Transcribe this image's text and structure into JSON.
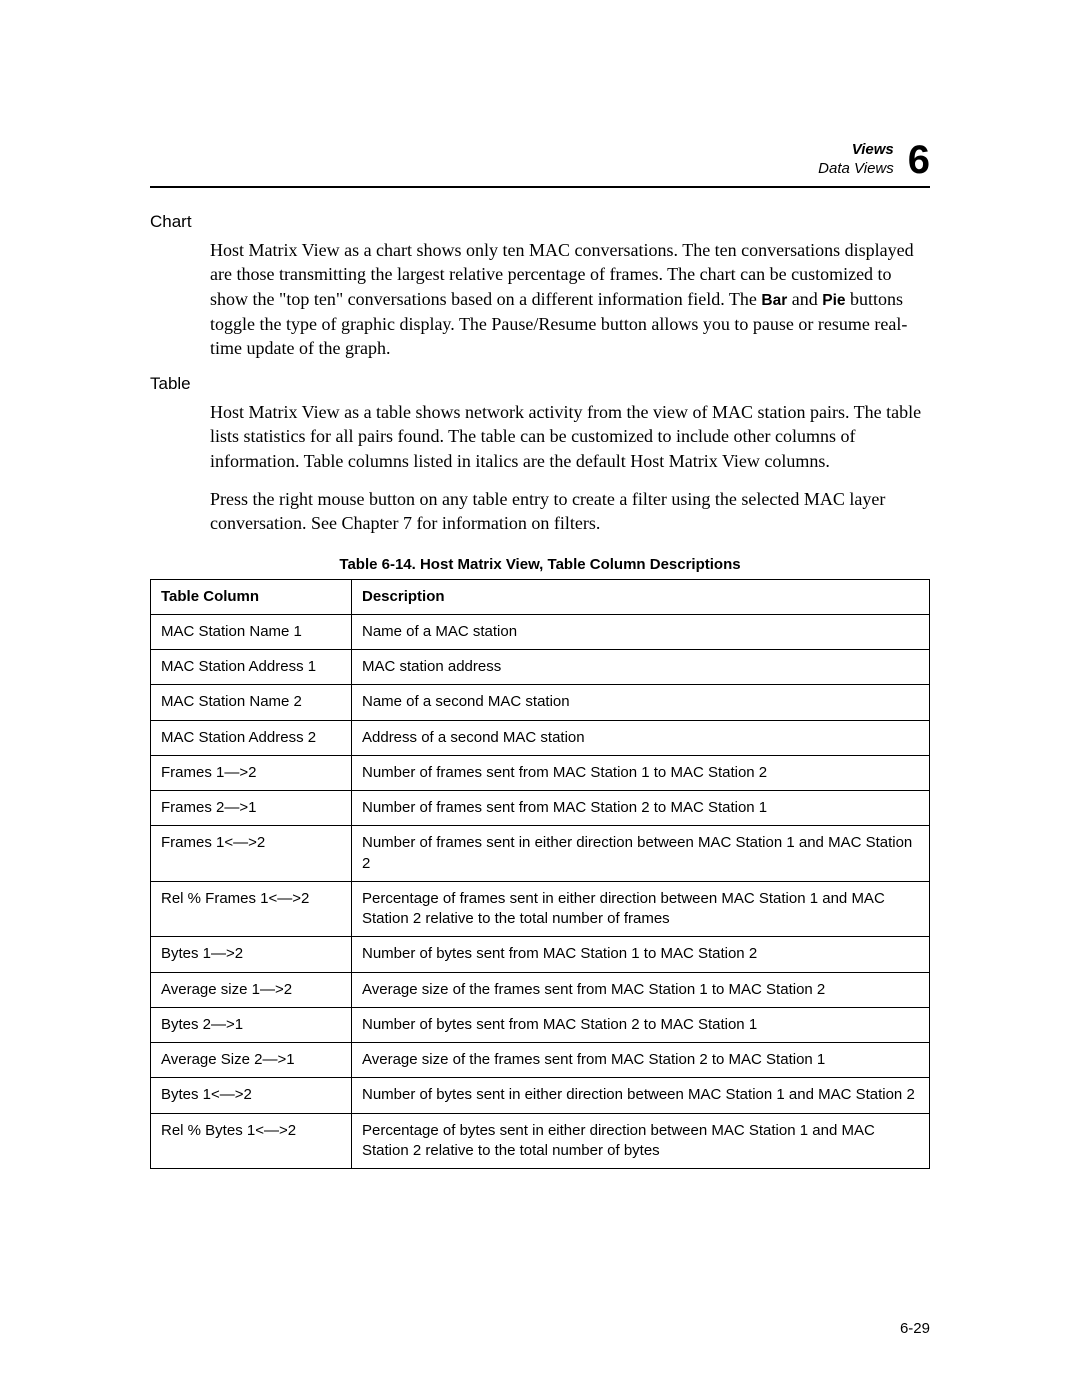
{
  "header": {
    "line1": "Views",
    "line2": "Data Views",
    "chapter_number": "6"
  },
  "sections": {
    "chart": {
      "heading": "Chart",
      "para_pre": "Host Matrix View as a chart shows only ten MAC conversations. The ten conversations displayed are those transmitting the largest relative percentage of frames. The chart can be customized to show the \"top ten\" conversations based on a different information field. The ",
      "bar_label": "Bar",
      "mid1": " and ",
      "pie_label": "Pie",
      "para_post": " buttons toggle the type of graphic display. The Pause/Resume button allows you to pause or resume real-time update of the graph."
    },
    "table": {
      "heading": "Table",
      "para1": "Host Matrix View as a table shows network activity from the view of MAC station pairs. The table lists statistics for all pairs found. The table can be customized to include other columns of information. Table columns listed in italics are the default Host Matrix View columns.",
      "para2": "Press the right mouse button on any table entry to create a filter using the selected MAC layer conversation. See Chapter 7 for information on filters."
    }
  },
  "table_caption": "Table 6-14. Host Matrix View, Table Column Descriptions",
  "table_headers": {
    "col1": "Table Column",
    "col2": "Description"
  },
  "rows": [
    {
      "c1": "MAC Station Name 1",
      "c2": "Name of a MAC station"
    },
    {
      "c1": "MAC Station Address 1",
      "c2": "MAC station address"
    },
    {
      "c1": "MAC Station Name 2",
      "c2": "Name of a second MAC station"
    },
    {
      "c1": "MAC Station Address 2",
      "c2": "Address of a second MAC station"
    },
    {
      "c1": "Frames 1—>2",
      "c2": "Number of frames sent from MAC Station 1 to MAC Station 2"
    },
    {
      "c1": "Frames 2—>1",
      "c2": "Number of frames sent from MAC Station 2 to MAC Station 1"
    },
    {
      "c1": "Frames 1<—>2",
      "c2": "Number of frames sent in either direction between MAC Station 1 and MAC Station 2"
    },
    {
      "c1": "Rel % Frames 1<—>2",
      "c2": "Percentage of frames sent in either direction between MAC Station 1 and MAC Station 2 relative to the total number of frames"
    },
    {
      "c1": "Bytes 1—>2",
      "c2": "Number of bytes sent from MAC Station 1 to MAC Station 2"
    },
    {
      "c1": "Average size 1—>2",
      "c2": "Average size of the frames sent from MAC Station 1 to MAC Station 2"
    },
    {
      "c1": "Bytes 2—>1",
      "c2": "Number of bytes sent from MAC Station 2 to MAC Station 1"
    },
    {
      "c1": "Average Size 2—>1",
      "c2": "Average size of the frames sent from MAC Station 2 to MAC Station 1"
    },
    {
      "c1": "Bytes 1<—>2",
      "c2": "Number of bytes sent in either direction between MAC Station 1 and MAC Station 2"
    },
    {
      "c1": "Rel % Bytes 1<—>2",
      "c2": "Percentage of bytes sent in either direction between MAC Station 1 and MAC Station 2 relative to the total number of bytes"
    }
  ],
  "page_number": "6-29"
}
